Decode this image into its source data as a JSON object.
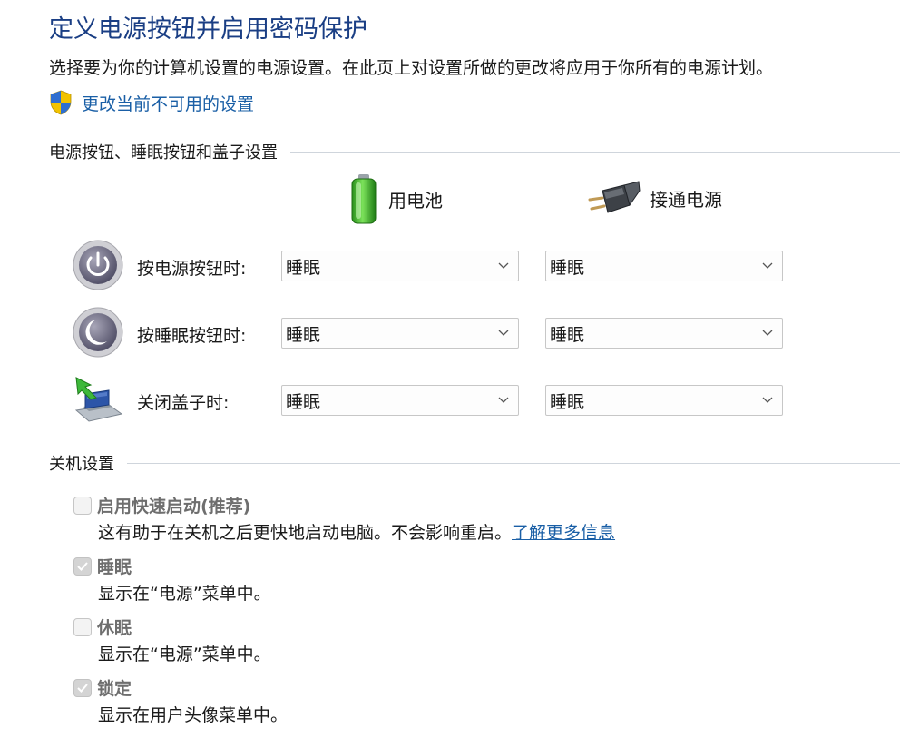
{
  "header": {
    "title": "定义电源按钮并启用密码保护",
    "description": "选择要为你的计算机设置的电源设置。在此页上对设置所做的更改将应用于你所有的电源计划。",
    "change_settings_link": "更改当前不可用的设置"
  },
  "power_section": {
    "label": "电源按钮、睡眠按钮和盖子设置",
    "columns": {
      "battery": "用电池",
      "plugged_in": "接通电源"
    },
    "rows": [
      {
        "label": "按电源按钮时:",
        "battery": "睡眠",
        "plugged": "睡眠"
      },
      {
        "label": "按睡眠按钮时:",
        "battery": "睡眠",
        "plugged": "睡眠"
      },
      {
        "label": "关闭盖子时:",
        "battery": "睡眠",
        "plugged": "睡眠"
      }
    ]
  },
  "shutdown_section": {
    "label": "关机设置",
    "fast_startup": {
      "label": "启用快速启动(推荐)",
      "description": "这有助于在关机之后更快地启动电脑。不会影响重启。",
      "link": "了解更多信息",
      "checked": false
    },
    "sleep": {
      "label": "睡眠",
      "description": "显示在“电源”菜单中。",
      "checked": true
    },
    "hibernate": {
      "label": "休眠",
      "description": "显示在“电源”菜单中。",
      "checked": false
    },
    "lock": {
      "label": "锁定",
      "description": "显示在用户头像菜单中。",
      "checked": true
    }
  },
  "colors": {
    "title": "#1a3e84",
    "link": "#1a5fa6",
    "disabled_label": "#6e6e6e"
  }
}
